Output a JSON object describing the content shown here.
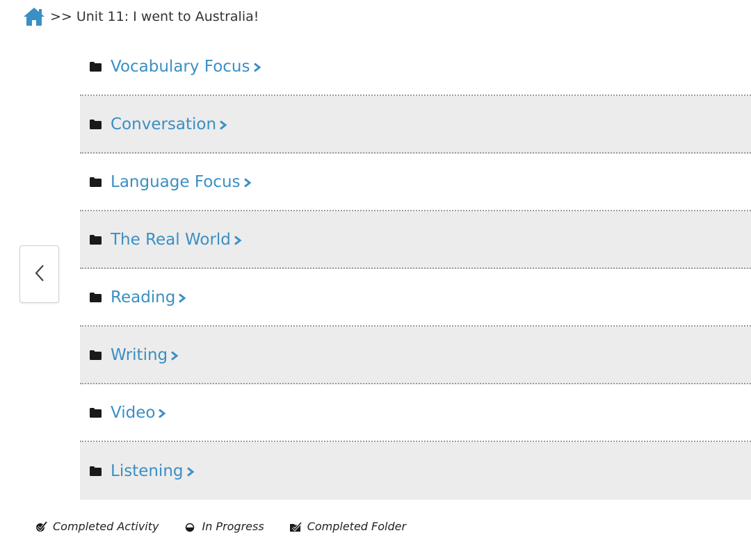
{
  "breadcrumb": {
    "home_icon": "home-icon",
    "separator": ">>",
    "title": "Unit 11: I went to Australia!"
  },
  "navigation": {
    "back_icon": "chevron-left-icon"
  },
  "folders": [
    {
      "label": "Vocabulary Focus",
      "icon": "folder-icon"
    },
    {
      "label": "Conversation",
      "icon": "folder-icon"
    },
    {
      "label": "Language Focus",
      "icon": "folder-icon"
    },
    {
      "label": "The Real World",
      "icon": "folder-icon"
    },
    {
      "label": "Reading",
      "icon": "folder-icon"
    },
    {
      "label": "Writing",
      "icon": "folder-icon"
    },
    {
      "label": "Video",
      "icon": "folder-icon"
    },
    {
      "label": "Listening",
      "icon": "folder-icon"
    }
  ],
  "legend": {
    "completed_activity": "Completed Activity",
    "in_progress": "In Progress",
    "completed_folder": "Completed Folder"
  },
  "colors": {
    "link": "#3a8fc4",
    "home": "#3a8fc4",
    "row_shade": "#ececec"
  }
}
